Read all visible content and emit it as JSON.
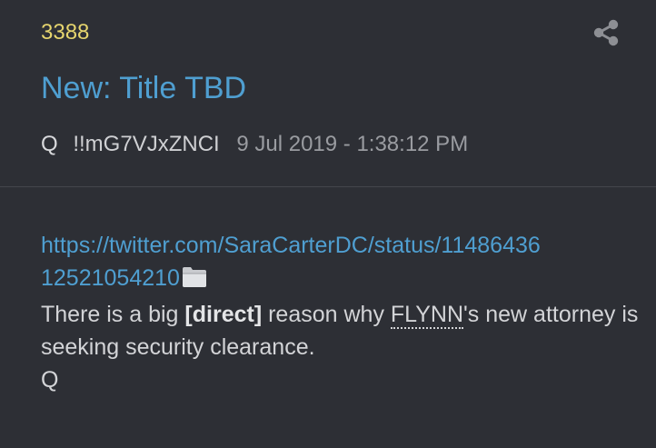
{
  "post": {
    "number": "3388",
    "title": "New: Title TBD",
    "author": "Q",
    "tripcode": "!!mG7VJxZNCI",
    "date": "9 Jul 2019 - 1:38:12 PM",
    "link_line1": "https://twitter.com/SaraCarterDC/status/11486436",
    "link_line2": "12521054210",
    "text_pre": "There is a big ",
    "text_bold": "[direct]",
    "text_mid": " reason why ",
    "text_underlined": "FLYNN",
    "text_post": "'s new attorney is seeking security clearance.",
    "signature": "Q"
  },
  "icons": {
    "share": "share-icon",
    "folder": "folder-icon"
  },
  "colors": {
    "background": "#2d2f35",
    "post_number": "#e6d56e",
    "link": "#4f9fd1",
    "text": "#d3d4d7"
  }
}
